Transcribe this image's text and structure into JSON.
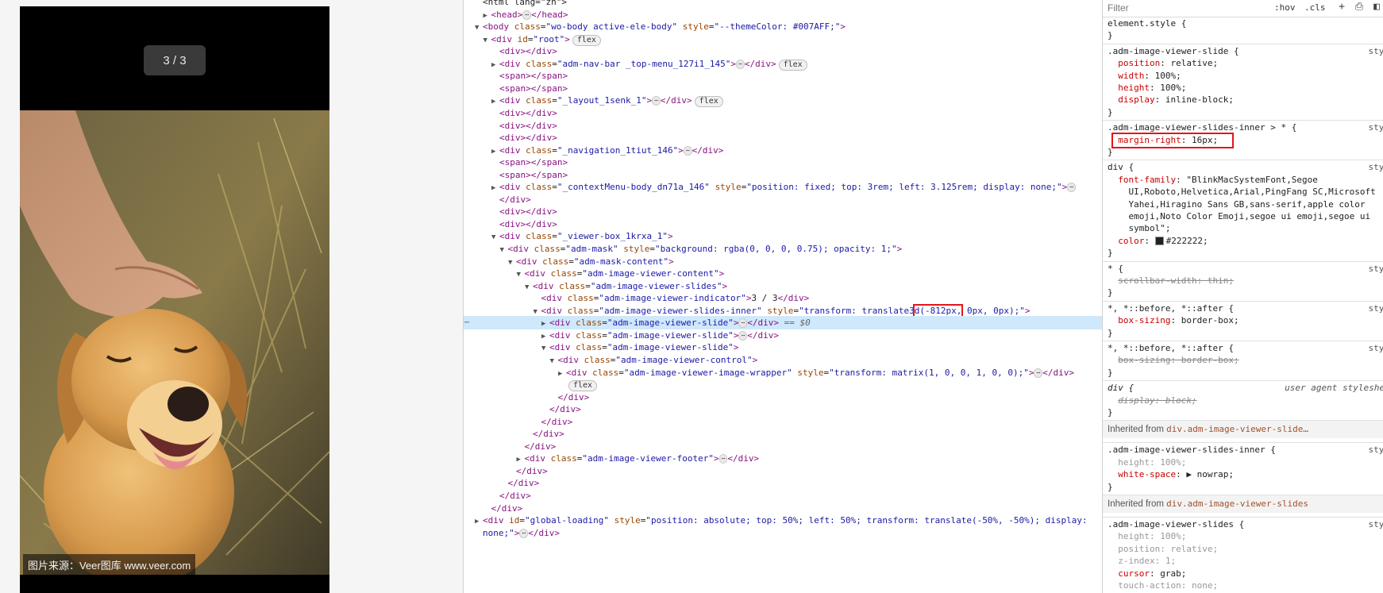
{
  "preview": {
    "indicator": "3 / 3",
    "credit": "图片来源：Veer图库 www.veer.com"
  },
  "elements": {
    "lines": [
      {
        "indent": 0,
        "tri": "",
        "html": "<span class='txt'>&lt;html lang=\"zh\"&gt;</span>"
      },
      {
        "indent": 1,
        "tri": "▶",
        "html": "<span class='tag'>&lt;head&gt;</span><span class='ell'>⋯</span><span class='tag'>&lt;/head&gt;</span>"
      },
      {
        "indent": 0,
        "tri": "▼",
        "html": "<span class='tag'>&lt;body</span> <span class='attr'>class</span>=<span class='val'>\"wo-body active-ele-body\"</span> <span class='attr'>style</span>=<span class='val'>\"--themeColor: #007AFF;\"</span><span class='tag'>&gt;</span>"
      },
      {
        "indent": 1,
        "tri": "▼",
        "html": "<span class='tag'>&lt;div</span> <span class='attr'>id</span>=<span class='val'>\"root\"</span><span class='tag'>&gt;</span><span class='badge'>flex</span>"
      },
      {
        "indent": 2,
        "tri": "",
        "html": "<span class='tag'>&lt;div&gt;&lt;/div&gt;</span>"
      },
      {
        "indent": 2,
        "tri": "▶",
        "html": "<span class='tag'>&lt;div</span> <span class='attr'>class</span>=<span class='val'>\"adm-nav-bar _top-menu_127i1_145\"</span><span class='tag'>&gt;</span><span class='ell'>⋯</span><span class='tag'>&lt;/div&gt;</span><span class='badge'>flex</span>"
      },
      {
        "indent": 2,
        "tri": "",
        "html": "<span class='tag'>&lt;span&gt;&lt;/span&gt;</span>"
      },
      {
        "indent": 2,
        "tri": "",
        "html": "<span class='tag'>&lt;span&gt;&lt;/span&gt;</span>"
      },
      {
        "indent": 2,
        "tri": "▶",
        "html": "<span class='tag'>&lt;div</span> <span class='attr'>class</span>=<span class='val'>\"_layout_1senk_1\"</span><span class='tag'>&gt;</span><span class='ell'>⋯</span><span class='tag'>&lt;/div&gt;</span><span class='badge'>flex</span>"
      },
      {
        "indent": 2,
        "tri": "",
        "html": "<span class='tag'>&lt;div&gt;&lt;/div&gt;</span>"
      },
      {
        "indent": 2,
        "tri": "",
        "html": "<span class='tag'>&lt;div&gt;&lt;/div&gt;</span>"
      },
      {
        "indent": 2,
        "tri": "",
        "html": "<span class='tag'>&lt;div&gt;&lt;/div&gt;</span>"
      },
      {
        "indent": 2,
        "tri": "▶",
        "html": "<span class='tag'>&lt;div</span> <span class='attr'>class</span>=<span class='val'>\"_navigation_1tiut_146\"</span><span class='tag'>&gt;</span><span class='ell'>⋯</span><span class='tag'>&lt;/div&gt;</span>"
      },
      {
        "indent": 2,
        "tri": "",
        "html": "<span class='tag'>&lt;span&gt;&lt;/span&gt;</span>"
      },
      {
        "indent": 2,
        "tri": "",
        "html": "<span class='tag'>&lt;span&gt;&lt;/span&gt;</span>"
      },
      {
        "indent": 2,
        "tri": "▶",
        "html": "<span class='tag'>&lt;div</span> <span class='attr'>class</span>=<span class='val'>\"_contextMenu-body_dn71a_146\"</span> <span class='attr'>style</span>=<span class='val'>\"position: fixed; top: 3rem; left: 3.125rem; display: none;\"</span><span class='tag'>&gt;</span><span class='ell'>⋯</span>"
      },
      {
        "indent": 2,
        "tri": "",
        "html": "<span class='tag'>&lt;/div&gt;</span>"
      },
      {
        "indent": 2,
        "tri": "",
        "html": "<span class='tag'>&lt;div&gt;&lt;/div&gt;</span>"
      },
      {
        "indent": 2,
        "tri": "",
        "html": "<span class='tag'>&lt;div&gt;&lt;/div&gt;</span>"
      },
      {
        "indent": 2,
        "tri": "▼",
        "html": "<span class='tag'>&lt;div</span> <span class='attr'>class</span>=<span class='val'>\"_viewer-box_1krxa_1\"</span><span class='tag'>&gt;</span>"
      },
      {
        "indent": 3,
        "tri": "▼",
        "html": "<span class='tag'>&lt;div</span> <span class='attr'>class</span>=<span class='val'>\"adm-mask\"</span> <span class='attr'>style</span>=<span class='val'>\"background: rgba(0, 0, 0, 0.75); opacity: 1;\"</span><span class='tag'>&gt;</span>"
      },
      {
        "indent": 4,
        "tri": "▼",
        "html": "<span class='tag'>&lt;div</span> <span class='attr'>class</span>=<span class='val'>\"adm-mask-content\"</span><span class='tag'>&gt;</span>"
      },
      {
        "indent": 5,
        "tri": "▼",
        "html": "<span class='tag'>&lt;div</span> <span class='attr'>class</span>=<span class='val'>\"adm-image-viewer-content\"</span><span class='tag'>&gt;</span>"
      },
      {
        "indent": 6,
        "tri": "▼",
        "html": "<span class='tag'>&lt;div</span> <span class='attr'>class</span>=<span class='val'>\"adm-image-viewer-slides\"</span><span class='tag'>&gt;</span>"
      },
      {
        "indent": 7,
        "tri": "",
        "html": "<span class='tag'>&lt;div</span> <span class='attr'>class</span>=<span class='val'>\"adm-image-viewer-indicator\"</span><span class='tag'>&gt;</span><span class='txt'>3 / 3</span><span class='tag'>&lt;/div&gt;</span>"
      },
      {
        "indent": 7,
        "tri": "▼",
        "html": "<span class='tag'>&lt;div</span> <span class='attr'>class</span>=<span class='val'>\"adm-image-viewer-slides-inner\"</span> <span class='attr'>style</span>=<span class='val'>\"transform: translate3<span class='hl'>d(-812px,</span> 0px, 0px);\"</span><span class='tag'>&gt;</span>"
      },
      {
        "indent": 8,
        "tri": "▶",
        "sel": true,
        "html": "<span class='tag'>&lt;div</span> <span class='attr'>class</span>=<span class='val'>\"adm-image-viewer-slide\"</span><span class='tag'>&gt;</span><span class='ell'>⋯</span><span class='tag'>&lt;/div&gt;</span> <span class='eq'>== $0</span>"
      },
      {
        "indent": 8,
        "tri": "▶",
        "html": "<span class='tag'>&lt;div</span> <span class='attr'>class</span>=<span class='val'>\"adm-image-viewer-slide\"</span><span class='tag'>&gt;</span><span class='ell'>⋯</span><span class='tag'>&lt;/div&gt;</span>"
      },
      {
        "indent": 8,
        "tri": "▼",
        "html": "<span class='tag'>&lt;div</span> <span class='attr'>class</span>=<span class='val'>\"adm-image-viewer-slide\"</span><span class='tag'>&gt;</span>"
      },
      {
        "indent": 9,
        "tri": "▼",
        "html": "<span class='tag'>&lt;div</span> <span class='attr'>class</span>=<span class='val'>\"adm-image-viewer-control\"</span><span class='tag'>&gt;</span>"
      },
      {
        "indent": 10,
        "tri": "▶",
        "html": "<span class='tag'>&lt;div</span> <span class='attr'>class</span>=<span class='val'>\"adm-image-viewer-image-wrapper\"</span> <span class='attr'>style</span>=<span class='val'>\"transform: matrix(1, 0, 0, 1, 0, 0);\"</span><span class='tag'>&gt;</span><span class='ell'>⋯</span><span class='tag'>&lt;/div&gt;</span>"
      },
      {
        "indent": 10,
        "tri": "",
        "html": "<span class='badge'>flex</span>"
      },
      {
        "indent": 9,
        "tri": "",
        "html": "<span class='tag'>&lt;/div&gt;</span>"
      },
      {
        "indent": 8,
        "tri": "",
        "html": "<span class='tag'>&lt;/div&gt;</span>"
      },
      {
        "indent": 7,
        "tri": "",
        "html": "<span class='tag'>&lt;/div&gt;</span>"
      },
      {
        "indent": 6,
        "tri": "",
        "html": "<span class='tag'>&lt;/div&gt;</span>"
      },
      {
        "indent": 5,
        "tri": "",
        "html": "<span class='tag'>&lt;/div&gt;</span>"
      },
      {
        "indent": 5,
        "tri": "▶",
        "html": "<span class='tag'>&lt;div</span> <span class='attr'>class</span>=<span class='val'>\"adm-image-viewer-footer\"</span><span class='tag'>&gt;</span><span class='ell'>⋯</span><span class='tag'>&lt;/div&gt;</span>"
      },
      {
        "indent": 4,
        "tri": "",
        "html": "<span class='tag'>&lt;/div&gt;</span>"
      },
      {
        "indent": 3,
        "tri": "",
        "html": "<span class='tag'>&lt;/div&gt;</span>"
      },
      {
        "indent": 2,
        "tri": "",
        "html": "<span class='tag'>&lt;/div&gt;</span>"
      },
      {
        "indent": 1,
        "tri": "",
        "html": "<span class='tag'>&lt;/div&gt;</span>"
      },
      {
        "indent": 0,
        "tri": "▶",
        "html": "<span class='tag'>&lt;div</span> <span class='attr'>id</span>=<span class='val'>\"global-loading\"</span> <span class='attr'>style</span>=<span class='val'>\"position: absolute; top: 50%; left: 50%; transform: translate(-50%, -50%); display:</span>"
      },
      {
        "indent": 0,
        "tri": "",
        "html": "<span class='val'>none;\"</span><span class='tag'>&gt;</span><span class='ell'>⋯</span><span class='tag'>&lt;/div&gt;</span>"
      }
    ],
    "selected_dots": "⋯"
  },
  "styles": {
    "filter_placeholder": "Filter",
    "hov": ":hov",
    "cls": ".cls",
    "source_label": "styl",
    "ua_label": "user agent styleshe",
    "inherited_prefix": "Inherited from",
    "inherited_1": "div.adm-image-viewer-slide…",
    "inherited_2": "div.adm-image-viewer-slides",
    "lines": [
      {
        "html": "element.style {"
      },
      {
        "html": "}"
      },
      {
        "html": ".adm-image-viewer-slide {",
        "src": true
      },
      {
        "html": "&nbsp;&nbsp;<span class='prop'>position</span>: <span class='pval'>relative;</span>"
      },
      {
        "html": "&nbsp;&nbsp;<span class='prop'>width</span>: <span class='pval'>100%;</span>"
      },
      {
        "html": "&nbsp;&nbsp;<span class='prop'>height</span>: <span class='pval'>100%;</span>"
      },
      {
        "html": "&nbsp;&nbsp;<span class='prop'>display</span>: <span class='pval'>inline-block;</span>"
      },
      {
        "html": "}"
      },
      {
        "html": ".adm-image-viewer-slides-inner &gt; * {",
        "src": true
      },
      {
        "html": "&nbsp;&nbsp;<span class='prop'>margin-right</span>: <span class='pval'>16px;</span>"
      },
      {
        "html": "}"
      },
      {
        "html": "div {",
        "src": true
      },
      {
        "html": "&nbsp;&nbsp;<span class='prop'>font-family</span>: <span class='pval'>\"BlinkMacSystemFont,Segoe</span>"
      },
      {
        "html": "&nbsp;&nbsp;&nbsp;&nbsp;<span class='pval'>UI,Roboto,Helvetica,Arial,PingFang SC,Microsoft</span>"
      },
      {
        "html": "&nbsp;&nbsp;&nbsp;&nbsp;<span class='pval'>Yahei,Hiragino Sans GB,sans-serif,apple color</span>"
      },
      {
        "html": "&nbsp;&nbsp;&nbsp;&nbsp;<span class='pval'>emoji,Noto Color Emoji,segoe ui emoji,segoe ui</span>"
      },
      {
        "html": "&nbsp;&nbsp;&nbsp;&nbsp;<span class='pval'>symbol\";</span>"
      },
      {
        "html": "&nbsp;&nbsp;<span class='prop'>color</span>: <span class='swatch'></span><span class='pval'>#222222;</span>"
      },
      {
        "html": "}"
      },
      {
        "html": "* {",
        "src": true
      },
      {
        "html": "&nbsp;&nbsp;<span class='strike'>scrollbar-width: thin;</span>"
      },
      {
        "html": "}"
      },
      {
        "html": "*, *::before, *::after {",
        "src": true
      },
      {
        "html": "&nbsp;&nbsp;<span class='prop'>box-sizing</span>: <span class='pval'>border-box;</span>"
      },
      {
        "html": "}"
      },
      {
        "html": "*, *::before, *::after {",
        "src": true
      },
      {
        "html": "&nbsp;&nbsp;<span class='strike'>box-sizing: border-box;</span>"
      },
      {
        "html": "}"
      },
      {
        "html": "<i>div {</i>",
        "ua": true
      },
      {
        "html": "&nbsp;&nbsp;<span class='strike'><i>display: block;</i></span>"
      },
      {
        "html": "}"
      },
      {
        "inherit": 1
      },
      {
        "html": ".adm-image-viewer-slides-inner {",
        "src": true
      },
      {
        "html": "&nbsp;&nbsp;<span class='strike' style='text-decoration:none;color:#999'>height: 100%;</span>"
      },
      {
        "html": "&nbsp;&nbsp;<span class='prop'>white-space</span>: ▶ <span class='pval'>nowrap;</span>"
      },
      {
        "html": "}"
      },
      {
        "inherit": 2
      },
      {
        "html": ".adm-image-viewer-slides {",
        "src": true
      },
      {
        "html": "&nbsp;&nbsp;<span style='color:#999'>height: 100%;</span>"
      },
      {
        "html": "&nbsp;&nbsp;<span style='color:#999'>position: relative;</span>"
      },
      {
        "html": "&nbsp;&nbsp;<span style='color:#999'>z-index: 1;</span>"
      },
      {
        "html": "&nbsp;&nbsp;<span class='prop'>cursor</span>: <span class='pval'>grab;</span>"
      },
      {
        "html": "&nbsp;&nbsp;<span style='color:#999'>touch-action: none;</span>"
      },
      {
        "html": "}"
      }
    ]
  }
}
